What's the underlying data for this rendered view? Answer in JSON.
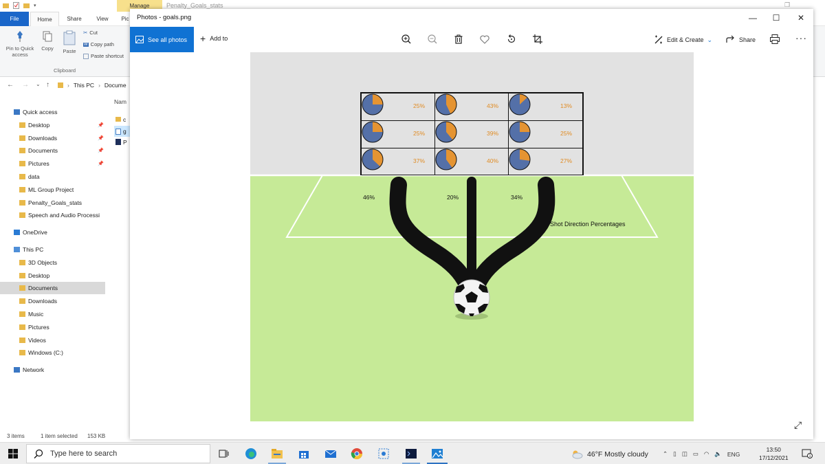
{
  "explorer": {
    "window_title": "Penalty_Goals_stats",
    "contextual_tab": "Manage",
    "tabs": [
      "File",
      "Home",
      "Share",
      "View",
      "Pic"
    ],
    "ribbon": {
      "pin_label": "Pin to Quick access",
      "copy_label": "Copy",
      "paste_label": "Paste",
      "cut_label": "Cut",
      "copy_path_label": "Copy path",
      "paste_shortcut_label": "Paste shortcut",
      "group_label": "Clipboard"
    },
    "breadcrumb": [
      "This PC",
      "Docume"
    ],
    "file_column_header": "Nam",
    "files": [
      "c",
      "g",
      "P"
    ],
    "nav": {
      "quick_access": "Quick access",
      "quick_items": [
        {
          "label": "Desktop",
          "pinned": true
        },
        {
          "label": "Downloads",
          "pinned": true
        },
        {
          "label": "Documents",
          "pinned": true
        },
        {
          "label": "Pictures",
          "pinned": true
        },
        {
          "label": "data",
          "pinned": false
        },
        {
          "label": "ML Group Project",
          "pinned": false
        },
        {
          "label": "Penalty_Goals_stats",
          "pinned": false
        },
        {
          "label": "Speech and Audio Processi",
          "pinned": false
        }
      ],
      "onedrive": "OneDrive",
      "this_pc": "This PC",
      "pc_items": [
        "3D Objects",
        "Desktop",
        "Documents",
        "Downloads",
        "Music",
        "Pictures",
        "Videos",
        "Windows (C:)"
      ],
      "selected": "Documents",
      "network": "Network"
    },
    "status": {
      "items": "3 items",
      "selected": "1 item selected",
      "size": "153 KB"
    }
  },
  "photos": {
    "title": "Photos - goals.png",
    "see_all": "See all photos",
    "add_to": "Add to",
    "edit_create": "Edit & Create",
    "share": "Share",
    "toolbar_icons": [
      "zoom-in-icon",
      "zoom-out-icon",
      "delete-icon",
      "favorite-icon",
      "rotate-icon",
      "crop-icon"
    ],
    "image": {
      "caption": "Shot Direction Percentages",
      "colors": {
        "scored": "#5470a8",
        "missed": "#e59432",
        "pitch": "#c6ea97",
        "sky": "#e2e2e2"
      },
      "direction_pct": [
        "46%",
        "20%",
        "34%"
      ]
    }
  },
  "chart_data": {
    "type": "pie",
    "description_free": true,
    "cells": [
      {
        "row": 1,
        "col": 1,
        "left": "75%",
        "right": "25%",
        "scored": 75,
        "missed": 25
      },
      {
        "row": 1,
        "col": 2,
        "left": "57%",
        "right": "43%",
        "scored": 57,
        "missed": 43
      },
      {
        "row": 1,
        "col": 3,
        "left": "87%",
        "right": "13%",
        "scored": 87,
        "missed": 13
      },
      {
        "row": 2,
        "col": 1,
        "left": "75%",
        "right": "25%",
        "scored": 75,
        "missed": 25
      },
      {
        "row": 2,
        "col": 2,
        "left": "61%",
        "right": "39%",
        "scored": 61,
        "missed": 39
      },
      {
        "row": 2,
        "col": 3,
        "left": "75%",
        "right": "25%",
        "scored": 75,
        "missed": 25
      },
      {
        "row": 3,
        "col": 1,
        "left": "63%",
        "right": "37%",
        "scored": 63,
        "missed": 37
      },
      {
        "row": 3,
        "col": 2,
        "left": "60%",
        "right": "40%",
        "scored": 60,
        "missed": 40
      },
      {
        "row": 3,
        "col": 3,
        "left": "73%",
        "right": "27%",
        "scored": 73,
        "missed": 27
      }
    ],
    "direction_values": [
      46,
      20,
      34
    ],
    "title": "Shot Direction Percentages"
  },
  "taskbar": {
    "search_placeholder": "Type here to search",
    "apps": [
      "task-view-icon",
      "edge-icon",
      "file-explorer-icon",
      "store-icon",
      "mail-icon",
      "chrome-icon",
      "snipping-icon",
      "vscode-icon",
      "photos-icon"
    ],
    "weather": "46°F  Mostly cloudy",
    "language": "ENG",
    "time": "13:50",
    "date": "17/12/2021",
    "notification_count": "1"
  }
}
